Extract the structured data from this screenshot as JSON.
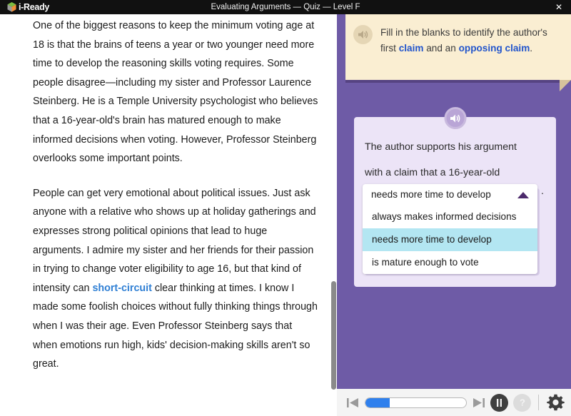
{
  "app": {
    "brand": "i-Ready",
    "title": "Evaluating Arguments — Quiz — Level F",
    "close_label": "✕",
    "brand_cube_colors": [
      "#7bbd42",
      "#f2903b",
      "#d8d8d8",
      "#9b9b9b"
    ]
  },
  "passage": {
    "paragraph_1_before_link": "One of the biggest reasons to keep the minimum voting age at 18 is that the brains of teens a year or two younger need more time to develop the reasoning skills voting requires. Some people disagree—including my sister and Professor Laurence Steinberg. He is a Temple University psychologist who believes that a 16-year-old's brain has matured enough to make informed decisions when voting. However, Professor Steinberg overlooks some important points.",
    "paragraph_2_part_a": "People can get very emotional about political issues. Just ask anyone with a relative who shows up at holiday gatherings and expresses strong political opinions that lead to huge arguments. I admire my sister and her friends for their passion in trying to change voter eligibility to age 16, but that kind of intensity can ",
    "paragraph_2_link": "short-circuit",
    "paragraph_2_part_b": " clear thinking at times. I know I made some foolish choices without fully thinking things through when I was their age. Even Professor Steinberg says that when emotions run high, kids' decision-making skills aren't so great."
  },
  "instruction": {
    "audio_icon": "speaker-icon",
    "text_part_a": "Fill in the blanks to identify the author's first ",
    "term_1": "claim",
    "text_part_b": " and an ",
    "term_2": "opposing claim",
    "text_part_c": "."
  },
  "question": {
    "audio_icon": "speaker-icon",
    "stem_line_1": "The author supports his argument",
    "stem_line_2": "with a claim that a 16-year-old",
    "trailing_punctuation": ".",
    "dropdown": {
      "selected_value": "needs more time to develop",
      "expanded": true,
      "caret_icon": "chevron-up-icon",
      "options": [
        {
          "label": "always makes informed decisions",
          "highlighted": false
        },
        {
          "label": "needs more time to develop",
          "highlighted": true
        },
        {
          "label": "is mature enough to vote",
          "highlighted": false
        }
      ],
      "highlight_color": "#b3e6f2"
    }
  },
  "controls": {
    "previous_label": "previous-item",
    "next_label": "next-item",
    "progress_percent": 24,
    "pause_label": "pause",
    "help_label": "help",
    "settings_label": "settings",
    "accent_color": "#2f80ed"
  }
}
